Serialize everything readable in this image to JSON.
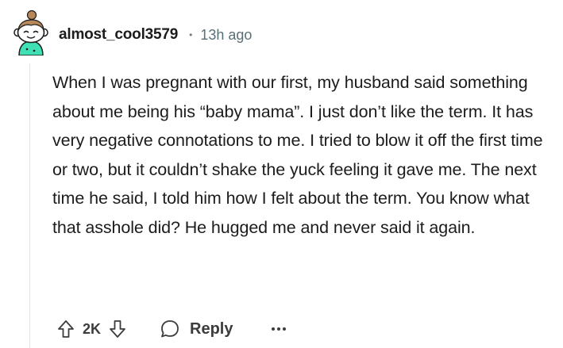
{
  "comment": {
    "author": "almost_cool3579",
    "separator": "•",
    "age": "13h ago",
    "body": "When I was pregnant with our first, my husband said something about me being his “baby mama”. I just don’t like the term. It has very negative connotations to me. I tried to blow it off the first time or two, but it couldn’t shake the yuck feeling it gave me. The next time he said, I told him how I felt about the term. You know what that asshole did? He hugged me and never said it again."
  },
  "actions": {
    "score": "2K",
    "reply_label": "Reply",
    "upvote_icon": "upvote-arrow-icon",
    "downvote_icon": "downvote-arrow-icon",
    "reply_icon": "speech-bubble-icon",
    "more_icon": "ellipsis-icon"
  },
  "colors": {
    "text": "#1c1c1c",
    "meta": "#576f76",
    "avatar_shirt": "#3ee0b4",
    "thread_line": "#e0e4e6"
  }
}
